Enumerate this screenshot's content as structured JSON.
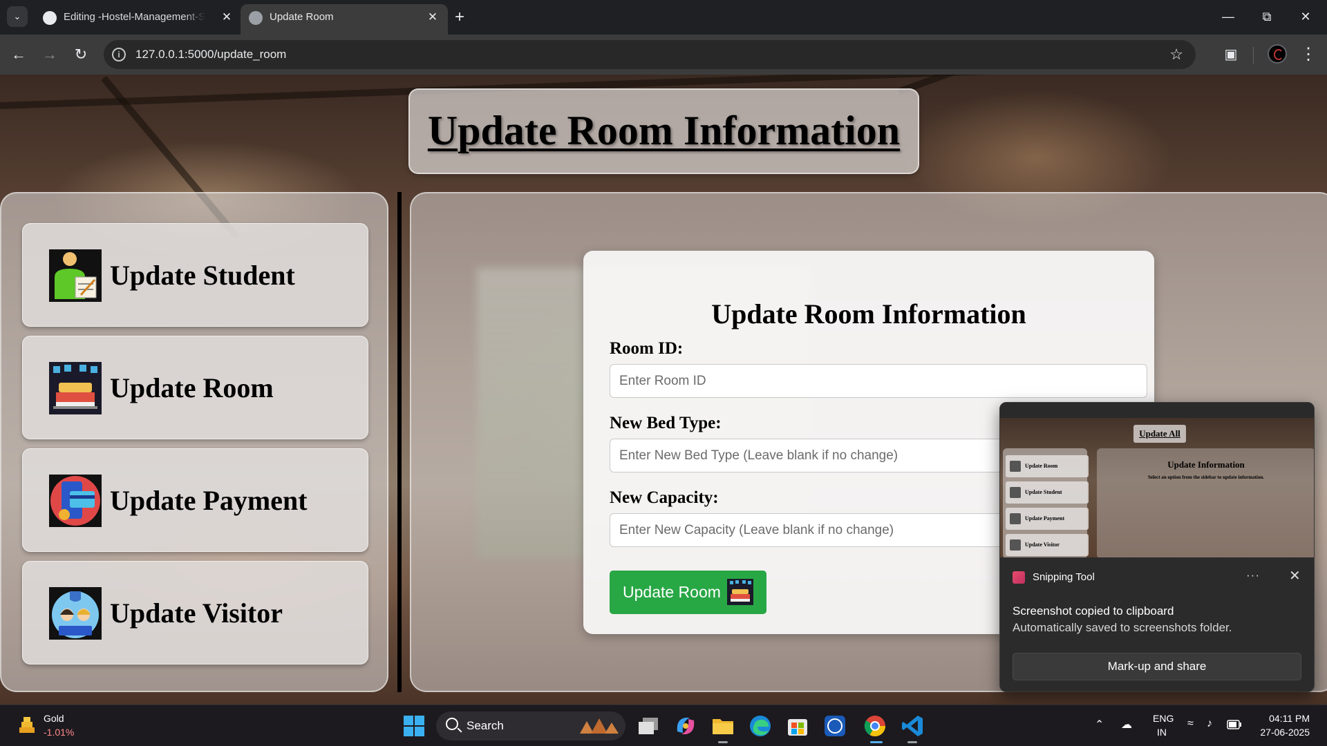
{
  "browser": {
    "tabs": [
      {
        "label": "Editing -Hostel-Management-S",
        "active": false
      },
      {
        "label": "Update Room",
        "active": true
      }
    ],
    "url": "127.0.0.1:5000/update_room"
  },
  "page": {
    "title": "Update Room Information",
    "sidebar": {
      "items": [
        {
          "label": "Update Student",
          "icon": "student-icon"
        },
        {
          "label": "Update Room",
          "icon": "room-icon"
        },
        {
          "label": "Update Payment",
          "icon": "payment-icon"
        },
        {
          "label": "Update Visitor",
          "icon": "visitor-icon"
        }
      ]
    },
    "form": {
      "title": "Update Room Information",
      "fields": [
        {
          "label": "Room ID:",
          "placeholder": "Enter Room ID",
          "value": ""
        },
        {
          "label": "New Bed Type:",
          "placeholder": "Enter New Bed Type (Leave blank if no change)",
          "value": ""
        },
        {
          "label": "New Capacity:",
          "placeholder": "Enter New Capacity (Leave blank if no change)",
          "value": ""
        }
      ],
      "submit_label": "Update Room",
      "submit_color": "#28a745"
    }
  },
  "toast": {
    "app": "Snipping Tool",
    "title": "Screenshot copied to clipboard",
    "body": "Automatically saved to screenshots folder.",
    "action": "Mark-up and share",
    "thumbnail": {
      "title": "Update All",
      "items": [
        "Update Room",
        "Update Student",
        "Update Payment",
        "Update Visitor"
      ],
      "heading": "Update Information",
      "subtext": "Select an option from the sidebar to update information."
    }
  },
  "taskbar": {
    "widget": {
      "name": "Gold",
      "change": "-1.01%"
    },
    "search_label": "Search",
    "language": {
      "line1": "ENG",
      "line2": "IN"
    },
    "clock": {
      "time": "04:11 PM",
      "date": "27-06-2025"
    }
  }
}
